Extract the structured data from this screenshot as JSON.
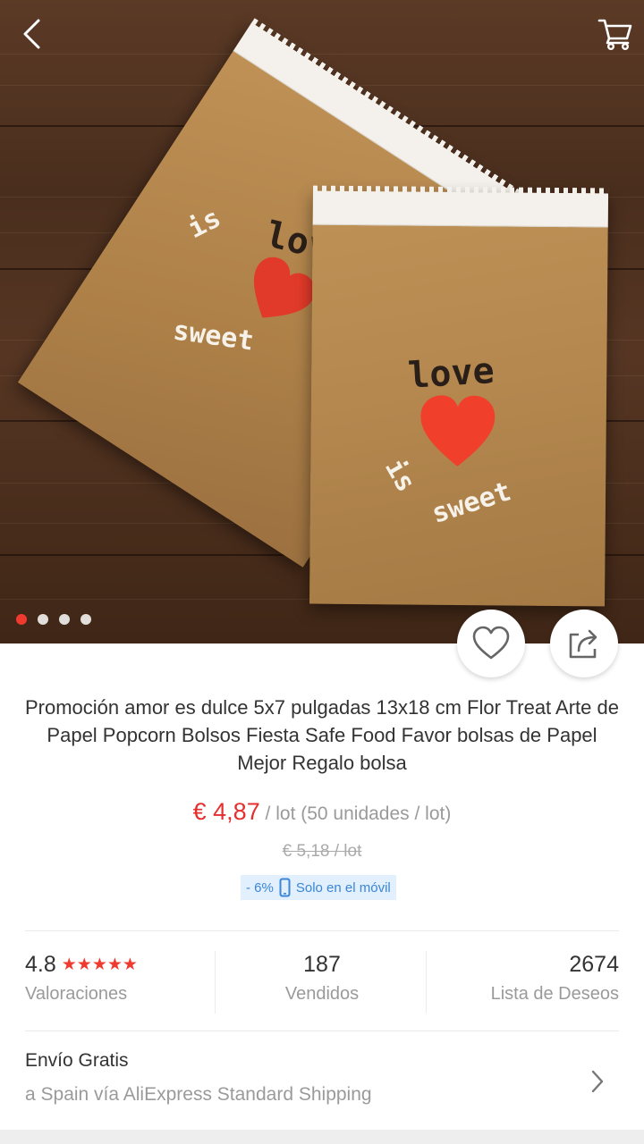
{
  "header": {
    "back_icon": "chevron-left-icon",
    "cart_icon": "shopping-cart-icon"
  },
  "gallery": {
    "image_count": 4,
    "active_index": 0,
    "bag_text_love": "love",
    "bag_text_is": "is",
    "bag_text_sweet": "sweet"
  },
  "actions": {
    "wishlist_icon": "heart-outline-icon",
    "share_icon": "share-icon"
  },
  "product": {
    "title": "Promoción amor es dulce 5x7 pulgadas 13x18 cm Flor Treat Arte de Papel Popcorn Bolsos Fiesta Safe Food Favor bolsas de Papel Mejor Regalo bolsa",
    "price": "€ 4,87",
    "price_unit": " / lot (50 unidades / lot)",
    "old_price": "€ 5,18  / lot",
    "discount": "- 6%",
    "mobile_only": "Solo en el móvil"
  },
  "stats": {
    "rating": "4.8",
    "stars": "★★★★★",
    "rating_label": "Valoraciones",
    "sold": "187",
    "sold_label": "Vendidos",
    "wishlist": "2674",
    "wishlist_label": "Lista de Deseos"
  },
  "shipping": {
    "title": "Envío Gratis",
    "subtitle": "a Spain vía AliExpress Standard Shipping"
  },
  "colors": {
    "accent_red": "#e52e2e",
    "promo_blue": "#3a86d8",
    "promo_bg": "#e2effc"
  }
}
